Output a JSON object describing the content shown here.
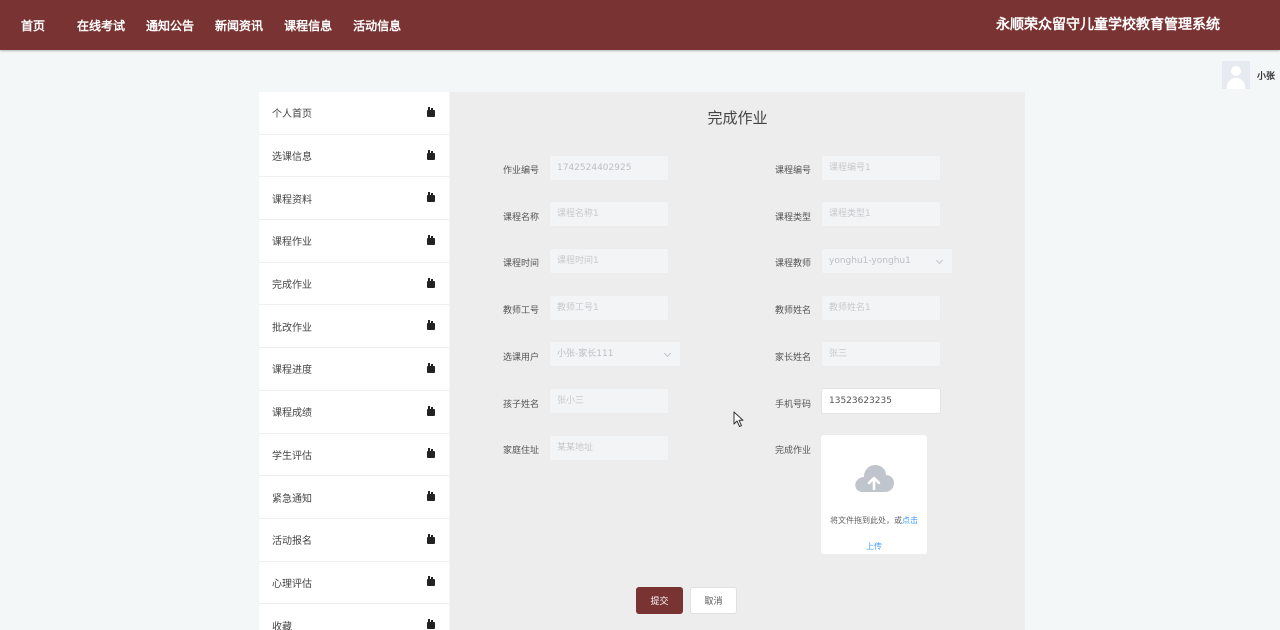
{
  "nav": {
    "home": "首页",
    "items": [
      "在线考试",
      "通知公告",
      "新闻资讯",
      "课程信息",
      "活动信息"
    ],
    "system_title": "永顺荣众留守儿童学校教育管理系统"
  },
  "user": {
    "name": "小张"
  },
  "sidebar": {
    "items": [
      {
        "label": "个人首页"
      },
      {
        "label": "选课信息"
      },
      {
        "label": "课程资料"
      },
      {
        "label": "课程作业"
      },
      {
        "label": "完成作业"
      },
      {
        "label": "批改作业"
      },
      {
        "label": "课程进度"
      },
      {
        "label": "课程成绩"
      },
      {
        "label": "学生评估"
      },
      {
        "label": "紧急通知"
      },
      {
        "label": "活动报名"
      },
      {
        "label": "心理评估"
      },
      {
        "label": "收藏"
      }
    ]
  },
  "page": {
    "title": "完成作业"
  },
  "form": {
    "homework_no": {
      "label": "作业编号",
      "value": "1742524402925"
    },
    "course_no": {
      "label": "课程编号",
      "placeholder": "课程编号1"
    },
    "course_name": {
      "label": "课程名称",
      "placeholder": "课程名称1"
    },
    "course_type": {
      "label": "课程类型",
      "placeholder": "课程类型1"
    },
    "course_time": {
      "label": "课程时间",
      "placeholder": "课程时间1"
    },
    "course_teacher": {
      "label": "课程教师",
      "value": "yonghu1-yonghu1"
    },
    "teacher_id": {
      "label": "教师工号",
      "placeholder": "教师工号1"
    },
    "teacher_name": {
      "label": "教师姓名",
      "placeholder": "教师姓名1"
    },
    "select_user": {
      "label": "选课用户",
      "value": "小张-家长111"
    },
    "parent_name": {
      "label": "家长姓名",
      "placeholder": "张三"
    },
    "child_name": {
      "label": "孩子姓名",
      "placeholder": "张小三"
    },
    "phone": {
      "label": "手机号码",
      "value": "13523623235"
    },
    "address": {
      "label": "家庭住址",
      "placeholder": "某某地址"
    },
    "upload": {
      "label": "完成作业",
      "text": "将文件拖到此处，或",
      "link": "点击",
      "link2": "上传"
    }
  },
  "buttons": {
    "submit": "提交",
    "cancel": "取消"
  },
  "colors": {
    "brand": "#7a3333",
    "link": "#409eff"
  }
}
